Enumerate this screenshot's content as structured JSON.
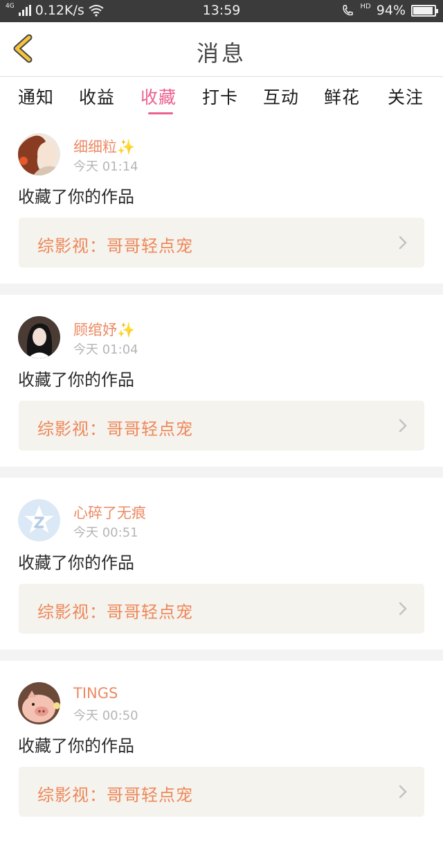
{
  "status_bar": {
    "net_type": "4G",
    "speed": "0.12K/s",
    "time": "13:59",
    "hd": "HD",
    "battery": "94%",
    "battery_level": 0.94
  },
  "header": {
    "title": "消息"
  },
  "tabs": [
    {
      "label": "通知"
    },
    {
      "label": "收益"
    },
    {
      "label": "收藏",
      "active": true
    },
    {
      "label": "打卡"
    },
    {
      "label": "互动"
    },
    {
      "label": "鲜花"
    },
    {
      "label": "关注"
    }
  ],
  "feed": [
    {
      "user": "细细粒✨",
      "time": "今天 01:14",
      "action": "收藏了你的作品",
      "work": "综影视：哥哥轻点宠",
      "avatar": "anime-girl-avatar"
    },
    {
      "user": "顾绾妤✨",
      "time": "今天 01:04",
      "action": "收藏了你的作品",
      "work": "综影视：哥哥轻点宠",
      "avatar": "girl-portrait-avatar"
    },
    {
      "user": "心碎了无痕",
      "time": "今天 00:51",
      "action": "收藏了你的作品",
      "work": "综影视：哥哥轻点宠",
      "avatar": "default-star-avatar"
    },
    {
      "user": "TINGS",
      "time": "今天 00:50",
      "action": "收藏了你的作品",
      "work": "综影视：哥哥轻点宠",
      "avatar": "piglet-avatar"
    }
  ],
  "colors": {
    "accent_pink": "#ec5f8e",
    "username_orange": "#ec8a63",
    "work_title_orange": "#ef8758",
    "back_arrow_yellow": "#f5c43c"
  }
}
